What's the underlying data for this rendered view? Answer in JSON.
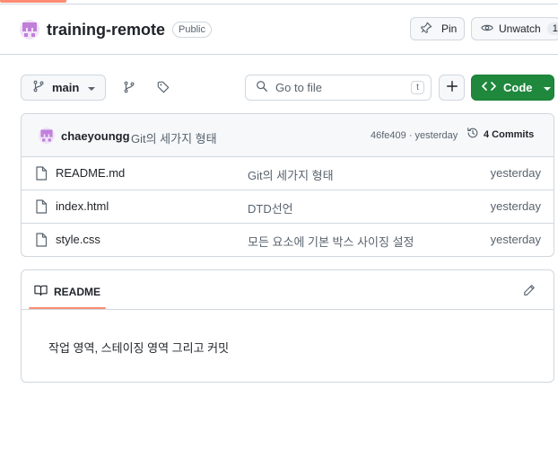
{
  "repo": {
    "name": "training-remote",
    "visibility": "Public",
    "pin_label": "Pin",
    "watch_label": "Unwatch",
    "watch_count": "1"
  },
  "toolbar": {
    "branch": "main",
    "search_placeholder": "Go to file",
    "search_shortcut": "t",
    "code_label": "Code"
  },
  "commit": {
    "author": "chaeyoungg",
    "message": "Git의 세가지 형태",
    "meta": "46fe409 · yesterday",
    "commits_label": "4 Commits"
  },
  "files": [
    {
      "name": "README.md",
      "message": "Git의 세가지 형태",
      "date": "yesterday"
    },
    {
      "name": "index.html",
      "message": "DTD선언",
      "date": "yesterday"
    },
    {
      "name": "style.css",
      "message": "모든 요소에 기본 박스 사이징 설정",
      "date": "yesterday"
    }
  ],
  "readme": {
    "tab_label": "README",
    "content": "작업 영역, 스테이징 영역 그리고 커밋"
  },
  "colors": {
    "accent": "#fd8c73",
    "code_button": "#1f883d",
    "border": "#d0d7de",
    "avatar": "#c07fd9"
  },
  "icons": [
    "repo-avatar-icon",
    "pin-icon",
    "eye-icon",
    "git-branch-icon",
    "caret-down-icon",
    "branches-icon",
    "tag-icon",
    "search-icon",
    "plus-icon",
    "code-icon",
    "history-icon",
    "file-icon",
    "book-icon",
    "pencil-icon"
  ]
}
